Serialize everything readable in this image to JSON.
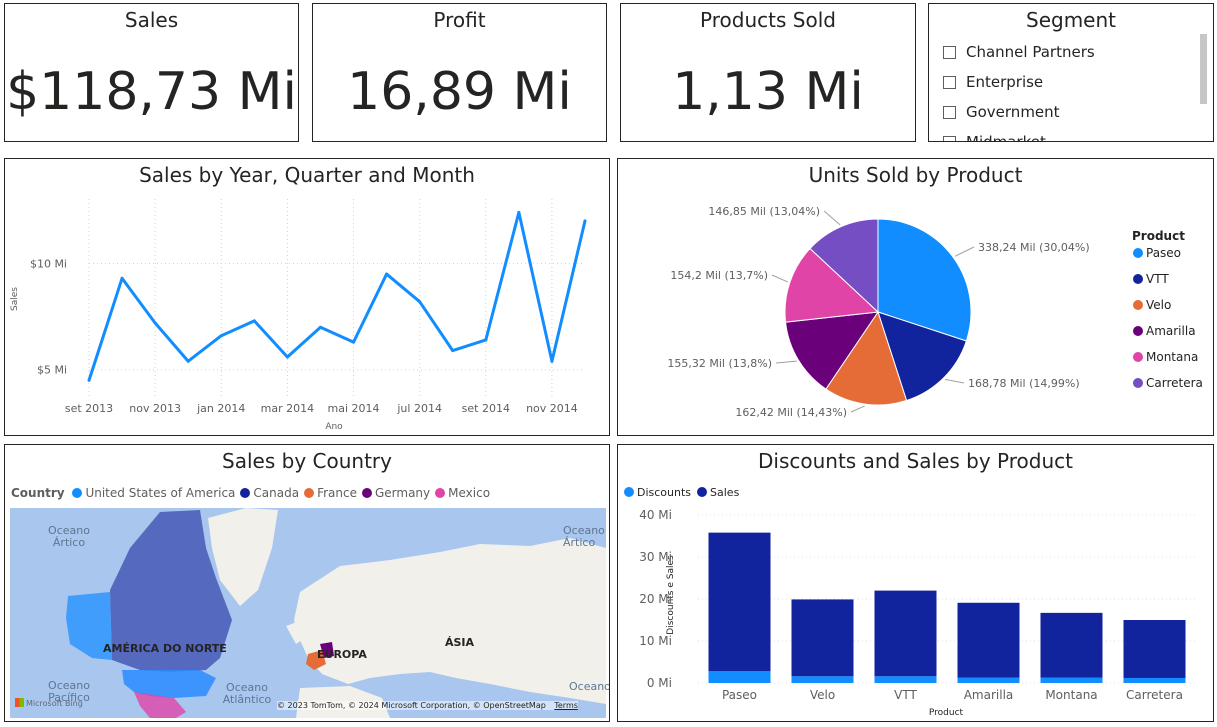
{
  "kpis": [
    {
      "title": "Sales",
      "value": "$118,73 Mi"
    },
    {
      "title": "Profit",
      "value": "16,89 Mi"
    },
    {
      "title": "Products Sold",
      "value": "1,13 Mi"
    }
  ],
  "segment": {
    "title": "Segment",
    "items": [
      "Channel Partners",
      "Enterprise",
      "Government",
      "Midmarket"
    ]
  },
  "colors": {
    "line": "#118DFF",
    "paseo": "#118DFF",
    "vtt": "#12239E",
    "velo": "#E66C37",
    "amarilla": "#6B007B",
    "montana": "#E044A7",
    "carretera": "#744EC2",
    "discounts": "#118DFF",
    "sales": "#12239E"
  },
  "chart_data": [
    {
      "type": "line",
      "title": "Sales by Year, Quarter and Month",
      "xlabel": "Ano",
      "ylabel": "Sales",
      "x": [
        "set 2013",
        "out 2013",
        "nov 2013",
        "dez 2013",
        "jan 2014",
        "fev 2014",
        "mar 2014",
        "abr 2014",
        "mai 2014",
        "jun 2014",
        "jul 2014",
        "ago 2014",
        "set 2014",
        "out 2014",
        "nov 2014",
        "dez 2014"
      ],
      "x_tick_labels": [
        "set 2013",
        "nov 2013",
        "jan 2014",
        "mar 2014",
        "mai 2014",
        "jul 2014",
        "set 2014",
        "nov 2014"
      ],
      "values": [
        4.5,
        9.3,
        7.2,
        5.4,
        6.6,
        7.3,
        5.6,
        7.0,
        6.3,
        9.5,
        8.2,
        5.9,
        6.4,
        12.4,
        5.4,
        12.0
      ],
      "y_tick_labels": [
        "$5 Mi",
        "$10 Mi"
      ],
      "yticks": [
        5,
        10
      ],
      "ylim": [
        4.0,
        13.5
      ],
      "grid": true
    },
    {
      "type": "pie",
      "title": "Units Sold by Product",
      "legend_title": "Product",
      "legend_position": "right",
      "labels": [
        "Paseo",
        "VTT",
        "Velo",
        "Amarilla",
        "Montana",
        "Carretera"
      ],
      "values": [
        338.24,
        168.78,
        162.42,
        155.32,
        154.2,
        146.85
      ],
      "data_labels": [
        "338,24 Mil (30,04%)",
        "168,78 Mil (14,99%)",
        "162,42 Mil (14,43%)",
        "155,32 Mil (13,8%)",
        "154,2 Mil (13,7%)",
        "146,85 Mil (13,04%)"
      ]
    },
    {
      "type": "map",
      "title": "Sales by Country",
      "legend_title": "Country",
      "categories": [
        "United States of America",
        "Canada",
        "France",
        "Germany",
        "Mexico"
      ],
      "map_labels": [
        "Oceano Ártico",
        "Oceano Ártico",
        "AMÉRICA DO NORTE",
        "EUROPA",
        "ÁSIA",
        "Oceano Pacífico",
        "Oceano Atlântico",
        "Oceano"
      ],
      "attribution": "© 2023 TomTom, © 2024 Microsoft Corporation, © OpenStreetMap",
      "terms": "Terms",
      "provider": "Microsoft Bing"
    },
    {
      "type": "bar",
      "title": "Discounts and Sales by Product",
      "xlabel": "Product",
      "ylabel": "Discounts e Sales",
      "categories": [
        "Paseo",
        "Velo",
        "VTT",
        "Amarilla",
        "Montana",
        "Carretera"
      ],
      "series": [
        {
          "name": "Discounts",
          "values": [
            2.8,
            1.6,
            1.6,
            1.3,
            1.3,
            1.2
          ]
        },
        {
          "name": "Sales",
          "values": [
            33.0,
            18.3,
            20.4,
            17.8,
            15.4,
            13.8
          ]
        }
      ],
      "stacked": true,
      "yticks": [
        0,
        10,
        20,
        30,
        40
      ],
      "y_tick_labels": [
        "0 Mi",
        "10 Mi",
        "20 Mi",
        "30 Mi",
        "40 Mi"
      ],
      "ylim": [
        0,
        40
      ],
      "legend_position": "top-left"
    }
  ]
}
